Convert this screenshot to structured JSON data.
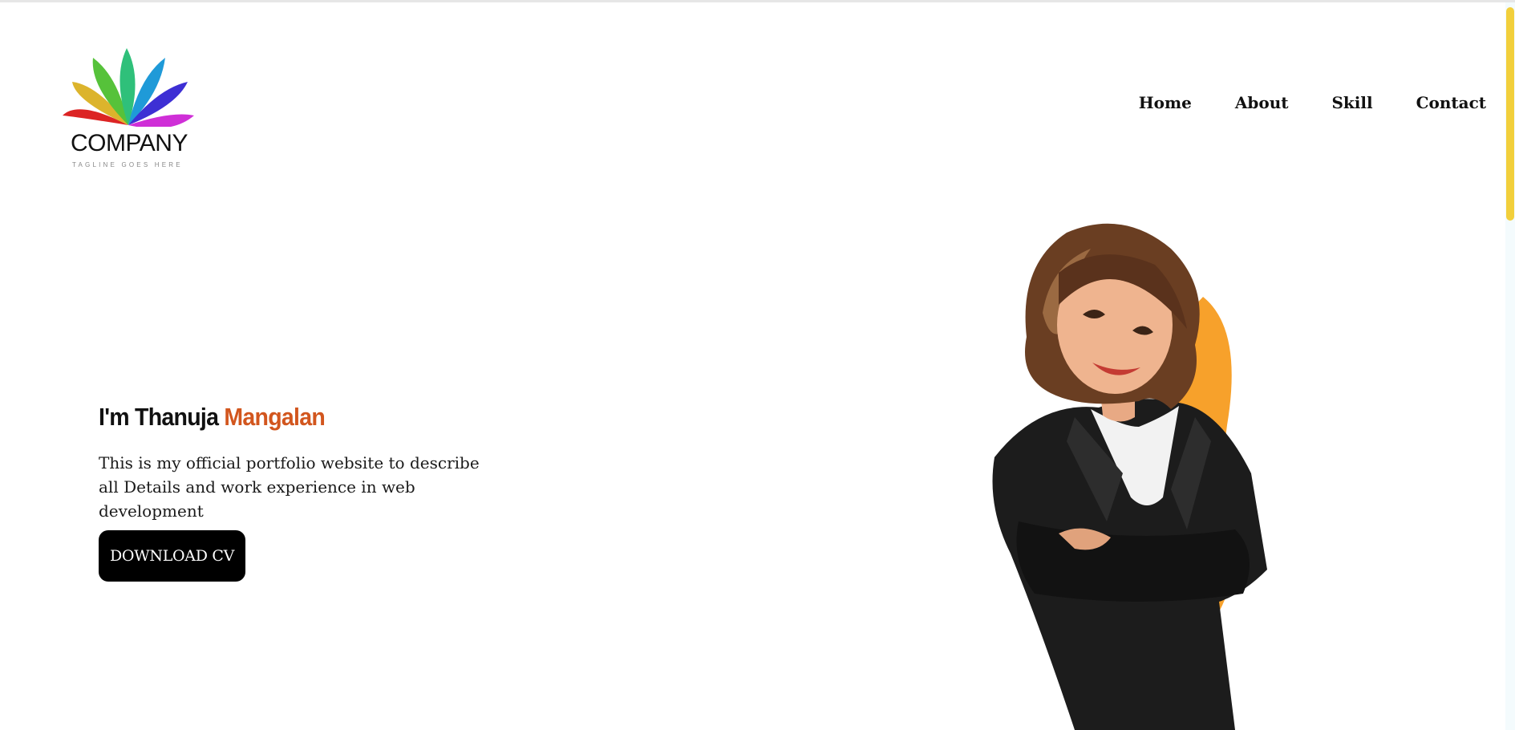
{
  "logo": {
    "name": "COMPANY",
    "tagline": "TAGLINE GOES HERE",
    "icon": "multicolor-leaf-fan-icon"
  },
  "nav": {
    "items": [
      {
        "label": "Home"
      },
      {
        "label": "About"
      },
      {
        "label": "Skill"
      },
      {
        "label": "Contact"
      }
    ]
  },
  "hero": {
    "greeting": "I'm Thanuja ",
    "highlight_name": "Mangalan",
    "description": "This is my official portfolio website to describe all Details and work experience in web development",
    "button_label": "DOWNLOAD CV",
    "illustration": "businesswoman-cartoon-illustration"
  },
  "colors": {
    "accent": "#d2561e",
    "button_bg": "#000000",
    "scrollbar_thumb": "#f2cf3b",
    "blob": "#f7a12b"
  }
}
